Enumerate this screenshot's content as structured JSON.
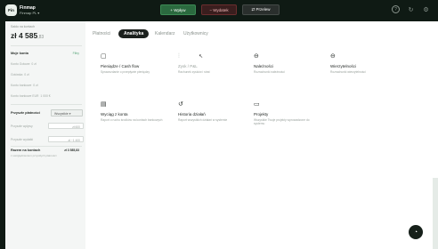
{
  "topbar": {
    "logo_text": "Fin",
    "org_name": "Finmap",
    "org_sub": "Finmap PL ▾",
    "buttons": {
      "income": "+ Wpływ",
      "expense": "− Wydatek",
      "transfer": "⇄ Przelew"
    },
    "icons": [
      "help-icon",
      "refresh-icon",
      "settings-icon"
    ]
  },
  "sidebar": {
    "balance_label": "Saldo na kontach",
    "balance_main": "zł 4 585",
    "balance_dec": ",83",
    "accounts_title": "Moje konta",
    "accounts_action": "Filtry",
    "accounts": [
      {
        "name": "Konto Gotowe",
        "value": "0 zł"
      },
      {
        "name": "Gotówka",
        "value": "0 zł"
      },
      {
        "name": "Konto bankowe",
        "value": "0 zł"
      },
      {
        "name": "Konto bankowe EUR",
        "value": "1 000 €"
      }
    ],
    "future_title": "Przyszłe płatności",
    "future_select": "Wszystkie ▾",
    "future_rows": [
      {
        "name": "Przyszłe wpływy",
        "value": "zł 600"
      },
      {
        "name": "Przyszłe wydatki",
        "value": "zł −1 400"
      }
    ],
    "total_title": "Razem na kontach",
    "total_value": "zł 3 585,83",
    "total_note": "z uwzględnieniem przyszłych płatności"
  },
  "tabs": [
    "Płatności",
    "Analityka",
    "Kalendarz",
    "Użytkownicy"
  ],
  "active_tab": "Analityka",
  "cards": [
    {
      "icon": "calendar-icon",
      "title": "Pieniądze / Cash flow",
      "desc": "Sprawozdanie o przepływie pieniędzy"
    },
    {
      "icon": "chart-icon",
      "title": "Zysk / P&L",
      "desc": "Rachunek zysków i strat"
    },
    {
      "icon": "arrow-in-icon",
      "title": "Należności",
      "desc": "Rozrachunki należności"
    },
    {
      "icon": "arrow-out-icon",
      "title": "Wierzytelności",
      "desc": "Rozrachunki wierzytelności"
    },
    {
      "icon": "document-icon",
      "title": "Wyciąg z konta",
      "desc": "Raport o ruchu środków na kontach bankowych"
    },
    {
      "icon": "history-icon",
      "title": "Historia działań",
      "desc": "Raport wszystkich działań w systemie"
    },
    {
      "icon": "folder-icon",
      "title": "Projekty",
      "desc": "Wszystkie Twoje projekty wprowadzone do systemu"
    }
  ],
  "colors": {
    "background": "#0f1a14",
    "income": "#2b6a3f",
    "expense": "#6a2e2e",
    "active_tab": "#1c211e"
  }
}
